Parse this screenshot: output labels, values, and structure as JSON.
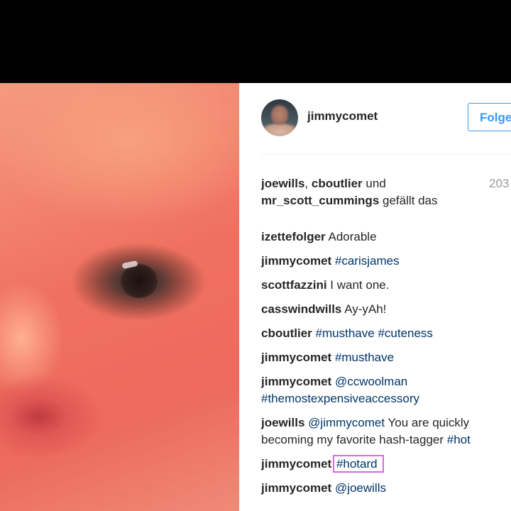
{
  "post": {
    "author": "jimmycomet",
    "follow_label": "Folge",
    "likes": {
      "users": [
        "joewills",
        "cboutlier"
      ],
      "connector": "und",
      "last_user": "mr_scott_cummings",
      "suffix": "gefällt das"
    },
    "time": "203",
    "comments": [
      {
        "user": "izettefolger",
        "parts": [
          {
            "type": "text",
            "value": "Adorable"
          }
        ]
      },
      {
        "user": "jimmycomet",
        "parts": [
          {
            "type": "tag",
            "value": "#carisjames"
          }
        ]
      },
      {
        "user": "scottfazzini",
        "parts": [
          {
            "type": "text",
            "value": "I want one."
          }
        ]
      },
      {
        "user": "casswindwills",
        "parts": [
          {
            "type": "text",
            "value": "Ay-yAh!"
          }
        ]
      },
      {
        "user": "cboutlier",
        "parts": [
          {
            "type": "tag",
            "value": "#musthave"
          },
          {
            "type": "tag",
            "value": "#cuteness"
          }
        ]
      },
      {
        "user": "jimmycomet",
        "parts": [
          {
            "type": "tag",
            "value": "#musthave"
          }
        ]
      },
      {
        "user": "jimmycomet",
        "parts": [
          {
            "type": "tag",
            "value": "@ccwoolman"
          },
          {
            "type": "br"
          },
          {
            "type": "tag",
            "value": "#themostexpensiveaccessory"
          }
        ]
      },
      {
        "user": "joewills",
        "parts": [
          {
            "type": "tag",
            "value": "@jimmycomet"
          },
          {
            "type": "text",
            "value": "You are quickly"
          },
          {
            "type": "br"
          },
          {
            "type": "text",
            "value": "becoming my favorite hash-tagger"
          },
          {
            "type": "tag",
            "value": "#hot"
          }
        ]
      },
      {
        "user": "jimmycomet",
        "highlight": true,
        "parts": [
          {
            "type": "tag",
            "value": "#hotard"
          }
        ]
      },
      {
        "user": "jimmycomet",
        "parts": [
          {
            "type": "tag",
            "value": "@joewills"
          }
        ]
      }
    ]
  }
}
